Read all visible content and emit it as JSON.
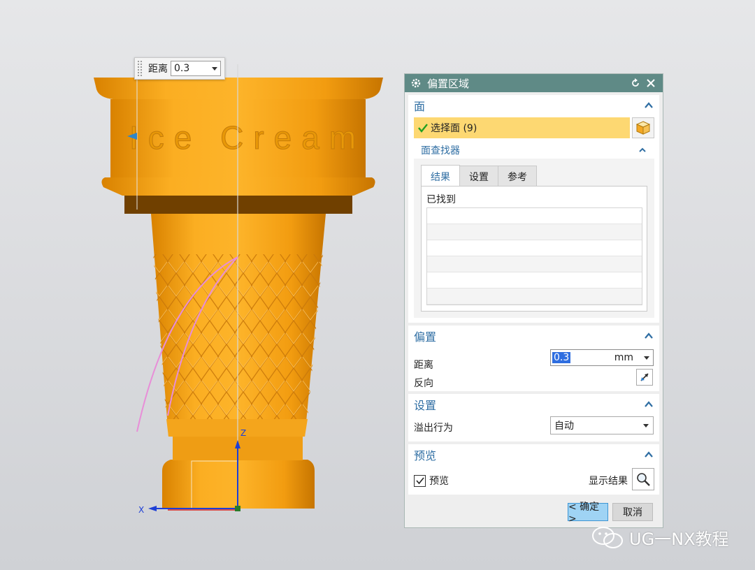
{
  "viewport": {
    "float_input": {
      "label": "距离",
      "value": "0.3"
    },
    "model_text": "Ice Cream",
    "axis": {
      "x": "X",
      "z": "Z"
    }
  },
  "dialog": {
    "title": "偏置区域",
    "face_section": {
      "title": "面",
      "select_label": "选择面 (9)",
      "finder": {
        "title": "面查找器",
        "tabs": [
          "结果",
          "设置",
          "参考"
        ],
        "active_tab": "结果",
        "found_label": "已找到"
      }
    },
    "offset_section": {
      "title": "偏置",
      "distance_label": "距离",
      "distance_value": "0.3",
      "distance_unit": "mm",
      "reverse_label": "反向"
    },
    "settings_section": {
      "title": "设置",
      "overflow_label": "溢出行为",
      "overflow_value": "自动"
    },
    "preview_section": {
      "title": "预览",
      "preview_label": "预览",
      "preview_checked": true,
      "show_result_label": "显示结果"
    },
    "ok_label": "< 确定 >",
    "cancel_label": "取消"
  },
  "watermark": "UG一NX教程",
  "colors": {
    "model": "#f5a00f",
    "title_bar": "#5f8a86",
    "section_title": "#2f6ea3",
    "selection_highlight": "#fdd872"
  }
}
